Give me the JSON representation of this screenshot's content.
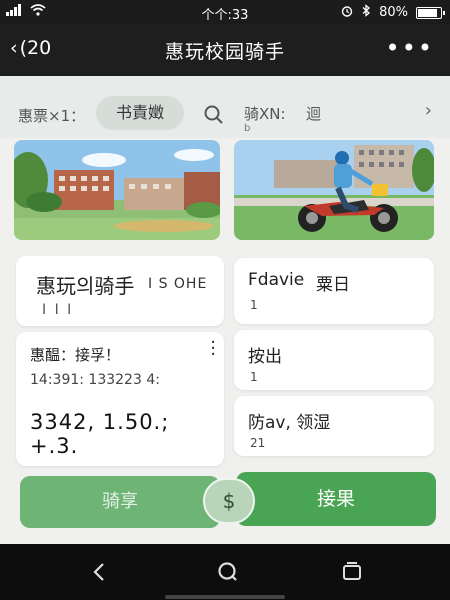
{
  "status_bar": {
    "time": "个个:33",
    "battery": "80%",
    "icons": [
      "signal-icon",
      "wifi-icon",
      "alarm-icon",
      "bluetooth-icon",
      "battery-icon"
    ]
  },
  "header": {
    "back_label": "(20",
    "title": "惠玩校园骑手",
    "more_label": "•••"
  },
  "filter": {
    "label1": "惠票×1：",
    "chip": "书責嬍",
    "label2": "骑XN:",
    "label3": "迴",
    "small": "b"
  },
  "cards": {
    "main": {
      "title": "惠玩의骑手",
      "title_extra": "I S OHE",
      "sub": "I I I"
    },
    "detail": {
      "title": "惠醖：接孚！",
      "sub": "14:391: 133223 4:",
      "big": "3342, 1.50.; +.3."
    },
    "right1": {
      "title": "Fdavie",
      "title2": "粟日",
      "num": "1"
    },
    "right2": {
      "title": "按出",
      "num": "1"
    },
    "right3": {
      "title": "防av, 领湿",
      "num": "21"
    }
  },
  "actions": {
    "left_label": "骑享",
    "coin_symbol": "$",
    "right_label": "接果"
  },
  "colors": {
    "accent_green": "#49a453",
    "header_bg": "#1e1e1e"
  }
}
